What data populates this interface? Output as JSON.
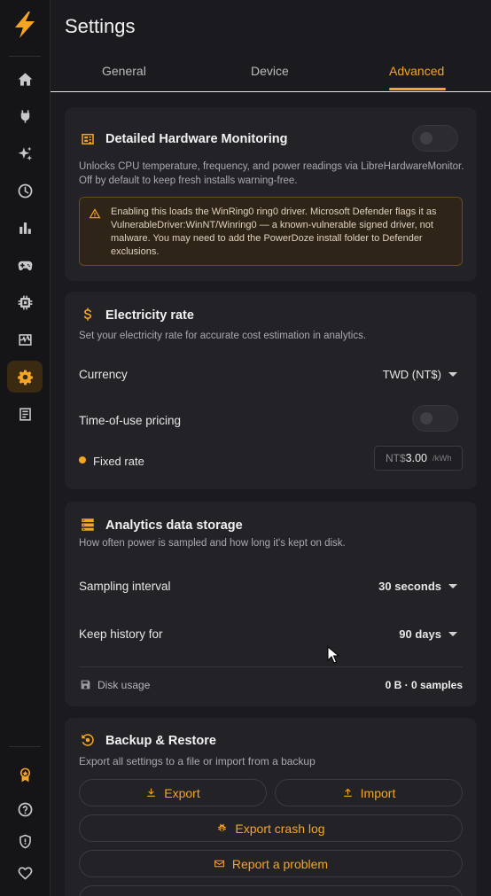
{
  "app": {
    "title": "Settings"
  },
  "sidebar": {
    "logo": "lightning-logo",
    "items": [
      {
        "icon": "home-icon"
      },
      {
        "icon": "plug-icon"
      },
      {
        "icon": "sparkles-icon"
      },
      {
        "icon": "clock-icon"
      },
      {
        "icon": "bar-chart-icon"
      },
      {
        "icon": "gamepad-icon"
      },
      {
        "icon": "cpu-icon"
      },
      {
        "icon": "activity-icon"
      },
      {
        "icon": "settings-icon",
        "active": true
      },
      {
        "icon": "log-icon"
      }
    ],
    "bottom": [
      {
        "icon": "award-icon"
      },
      {
        "icon": "help-icon"
      },
      {
        "icon": "shield-icon"
      },
      {
        "icon": "heart-icon"
      }
    ]
  },
  "tabs": [
    {
      "label": "General"
    },
    {
      "label": "Device"
    },
    {
      "label": "Advanced",
      "active": true
    }
  ],
  "hardware": {
    "title": "Detailed Hardware Monitoring",
    "desc": "Unlocks CPU temperature, frequency, and power readings via LibreHardwareMonitor. Off by default to keep fresh installs warning-free.",
    "enabled": false,
    "warning": "Enabling this loads the WinRing0 ring0 driver. Microsoft Defender flags it as VulnerableDriver:WinNT/Winring0 — a known-vulnerable signed driver, not malware. You may need to add the PowerDoze install folder to Defender exclusions."
  },
  "electricity": {
    "title": "Electricity rate",
    "desc": "Set your electricity rate for accurate cost estimation in analytics.",
    "currency_label": "Currency",
    "currency_value": "TWD (NT$)",
    "tou_label": "Time-of-use pricing",
    "tou_enabled": false,
    "fixed_label": "Fixed rate",
    "rate_prefix": "NT$",
    "rate_value": "3.00",
    "rate_unit": "/kWh"
  },
  "analytics": {
    "title": "Analytics data storage",
    "desc": "How often power is sampled and how long it's kept on disk.",
    "sampling_label": "Sampling interval",
    "sampling_value": "30 seconds",
    "history_label": "Keep history for",
    "history_value": "90 days",
    "disk_label": "Disk usage",
    "disk_value": "0 B  ·  0 samples"
  },
  "backup": {
    "title": "Backup & Restore",
    "desc": "Export all settings to a file or import from a backup",
    "export_label": "Export",
    "import_label": "Import",
    "crash_label": "Export crash log",
    "report_label": "Report a problem"
  },
  "colors": {
    "accent": "#f5a524",
    "background": "#1b1b1f",
    "card": "#232327"
  }
}
